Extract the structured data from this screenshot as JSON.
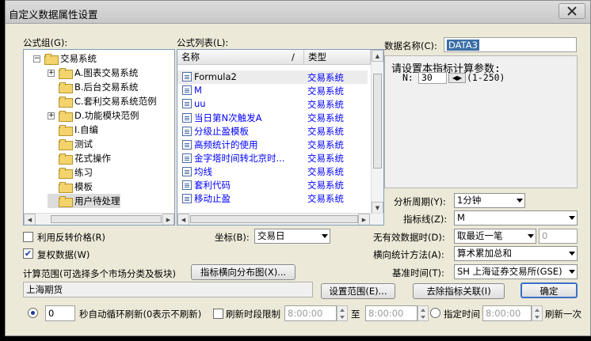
{
  "window": {
    "title": "自定义数据属性设置"
  },
  "formula_group": {
    "label": "公式组(G):",
    "root": "交易系统",
    "items": [
      {
        "label": "A.图表交易系统",
        "expander": "+"
      },
      {
        "label": "B.后台交易系统",
        "expander": ""
      },
      {
        "label": "C.套利交易系统范例",
        "expander": ""
      },
      {
        "label": "D.功能模块范例",
        "expander": "+"
      },
      {
        "label": "I.自编",
        "expander": ""
      },
      {
        "label": "测试",
        "expander": ""
      },
      {
        "label": "花式操作",
        "expander": ""
      },
      {
        "label": "练习",
        "expander": ""
      },
      {
        "label": "模板",
        "expander": ""
      },
      {
        "label": "用户待处理",
        "expander": ""
      }
    ]
  },
  "formula_list": {
    "label": "公式列表(L):",
    "col_name": "名称",
    "col_slash": "/",
    "col_type": "类型",
    "rows": [
      {
        "name": "Formula2",
        "type": "交易系统"
      },
      {
        "name": "M",
        "type": "交易系统"
      },
      {
        "name": "uu",
        "type": "交易系统"
      },
      {
        "name": "当日第N次触发A",
        "type": "交易系统"
      },
      {
        "name": "分级止盈模板",
        "type": "交易系统"
      },
      {
        "name": "高频统计的使用",
        "type": "交易系统"
      },
      {
        "name": "金字塔时间转北京时...",
        "type": "交易系统"
      },
      {
        "name": "均线",
        "type": "交易系统"
      },
      {
        "name": "套利代码",
        "type": "交易系统"
      },
      {
        "name": "移动止盈",
        "type": "交易系统"
      }
    ]
  },
  "data_name": {
    "label": "数据名称(C):",
    "value": "DATA3"
  },
  "params": {
    "title": "请设置本指标计算参数:",
    "param_name": "N:",
    "param_value": "30",
    "param_range": "(1-250)"
  },
  "period": {
    "label": "分析周期(Y):",
    "value": "1分钟"
  },
  "indicator_line": {
    "label": "指标线(Z):",
    "value": "M"
  },
  "reverse_price": {
    "label": "利用反转价格(R)",
    "checked": false
  },
  "restore_rights": {
    "label": "复权数据(W)",
    "checked": true
  },
  "coord": {
    "label": "坐标(B):",
    "value": "交易日"
  },
  "invalid_data": {
    "label": "无有效数据时(D):",
    "value": "取最近一笔",
    "extra_value": "0"
  },
  "horizontal_stat": {
    "label": "横向统计方法(A):",
    "value": "算术累加总和"
  },
  "base_time": {
    "label": "基准时间(T):",
    "value": "SH 上海证券交易所(GSE)"
  },
  "calc_range": {
    "label": "计算范围(可选择多个市场分类及板块)",
    "dist_button": "指标横向分布图(X)...",
    "value": "上海期货"
  },
  "buttons": {
    "set_range": "设置范围(E)...",
    "remove_link": "去除指标关联(I)",
    "ok": "确定"
  },
  "refresh": {
    "auto_value": "0",
    "auto_label": "秒自动循环刷新(0表示不刷新)",
    "time_limit_label": "刷新时段限制",
    "from_time": "8:00:00",
    "to_label": "至",
    "to_time": "8:00:00",
    "specify_label": "指定时间",
    "specify_time": "8:00:00",
    "once_label": "刷新一次"
  },
  "colors": {
    "accent": "#0000ff",
    "window_bg": "#ece9d8",
    "selection": "#3a6ea5"
  }
}
